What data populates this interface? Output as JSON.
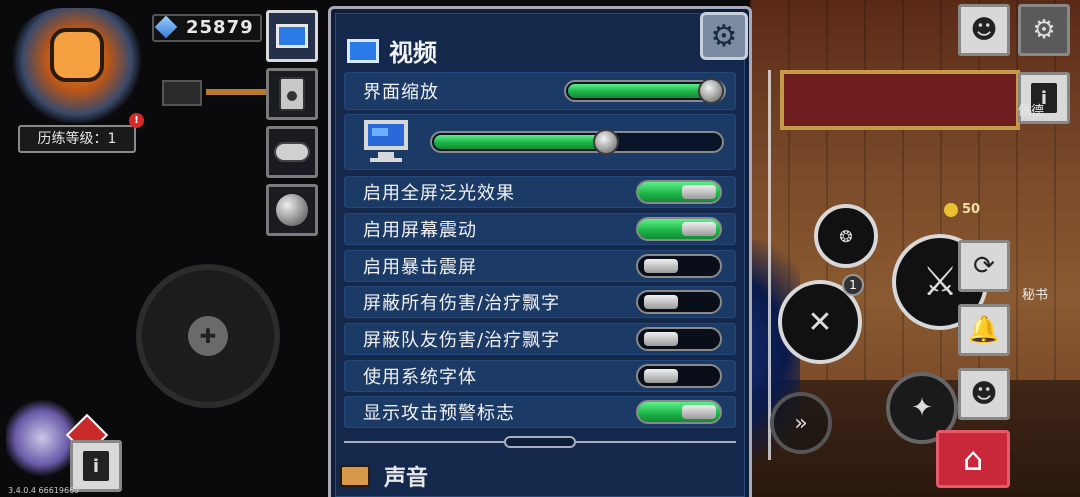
{
  "hud": {
    "level_label": "历练等级：1",
    "level_alert": "!",
    "gem_count": "25879"
  },
  "side_tabs": [
    {
      "name": "video-tab",
      "icon": "monitor-icon",
      "active": true
    },
    {
      "name": "audio-tab",
      "icon": "speaker-icon",
      "active": false
    },
    {
      "name": "controls-tab",
      "icon": "gamepad-icon",
      "active": false
    },
    {
      "name": "other-tab",
      "icon": "ball-icon",
      "active": false
    }
  ],
  "panel": {
    "title": "视频",
    "settings_icon": "gear-icon",
    "ui_scale": {
      "label": "界面缩放",
      "value_fraction": 1.0
    },
    "brightness": {
      "icon": "monitor-icon",
      "value_fraction": 0.61
    },
    "toggles": [
      {
        "label": "启用全屏泛光效果",
        "on": true
      },
      {
        "label": "启用屏幕震动",
        "on": true
      },
      {
        "label": "启用暴击震屏",
        "on": false
      },
      {
        "label": "屏蔽所有伤害/治疗飘字",
        "on": false
      },
      {
        "label": "屏蔽队友伤害/治疗飘字",
        "on": false
      },
      {
        "label": "使用系统字体",
        "on": false
      },
      {
        "label": "显示攻击预警标志",
        "on": true
      }
    ],
    "next_section": "声音"
  },
  "right_hud": {
    "coin_amount": "50",
    "npc_name_1": "佩德",
    "npc_name_2": "秘书",
    "skill_badge": "1"
  },
  "version": "3.4.0.4 66619669"
}
